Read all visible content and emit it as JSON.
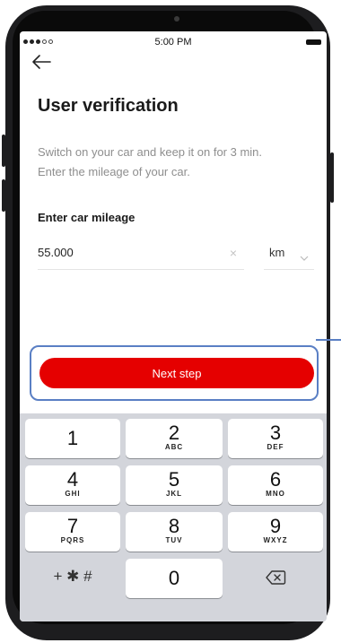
{
  "status_bar": {
    "time": "5:00 PM"
  },
  "page": {
    "title": "User verification",
    "description_line1": "Switch on your car and keep it on for 3 min.",
    "description_line2": "Enter the mileage of your car.",
    "field_label": "Enter car mileage"
  },
  "mileage_input": {
    "value": "55.000",
    "clear_symbol": "×"
  },
  "unit_select": {
    "selected": "km"
  },
  "next_button": {
    "label": "Next step"
  },
  "keypad": {
    "k1": {
      "number": "1",
      "letters": ""
    },
    "k2": {
      "number": "2",
      "letters": "ABC"
    },
    "k3": {
      "number": "3",
      "letters": "DEF"
    },
    "k4": {
      "number": "4",
      "letters": "GHI"
    },
    "k5": {
      "number": "5",
      "letters": "JKL"
    },
    "k6": {
      "number": "6",
      "letters": "MNO"
    },
    "k7": {
      "number": "7",
      "letters": "PQRS"
    },
    "k8": {
      "number": "8",
      "letters": "TUV"
    },
    "k9": {
      "number": "9",
      "letters": "WXYZ"
    },
    "k0": {
      "number": "0"
    },
    "symbols": "+ ✱ #"
  },
  "colors": {
    "accent_red": "#e50000",
    "highlight_blue": "#5a7fc4",
    "keyboard_bg": "#d3d5db"
  }
}
